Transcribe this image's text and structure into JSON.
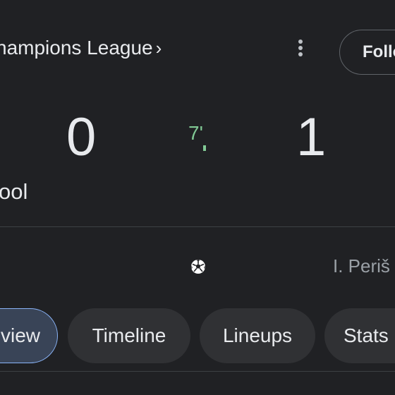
{
  "header": {
    "league_link": "hampions League",
    "league_chevron": "›",
    "more_icon": "more-vert-icon",
    "follow_label": "Follo"
  },
  "match": {
    "home_score": "0",
    "away_score": "1",
    "minute": "7'",
    "home_team": "ool",
    "status_color": "#81c995"
  },
  "events": {
    "goal_icon": "soccer-ball-icon",
    "scorer": "I. Periš"
  },
  "tabs": [
    {
      "label": "view",
      "active": true
    },
    {
      "label": "Timeline",
      "active": false
    },
    {
      "label": "Lineups",
      "active": false
    },
    {
      "label": "Stats",
      "active": false
    }
  ],
  "colors": {
    "background": "#202124",
    "text": "#e8eaed",
    "accent": "#8ab4f8",
    "live": "#81c995"
  }
}
